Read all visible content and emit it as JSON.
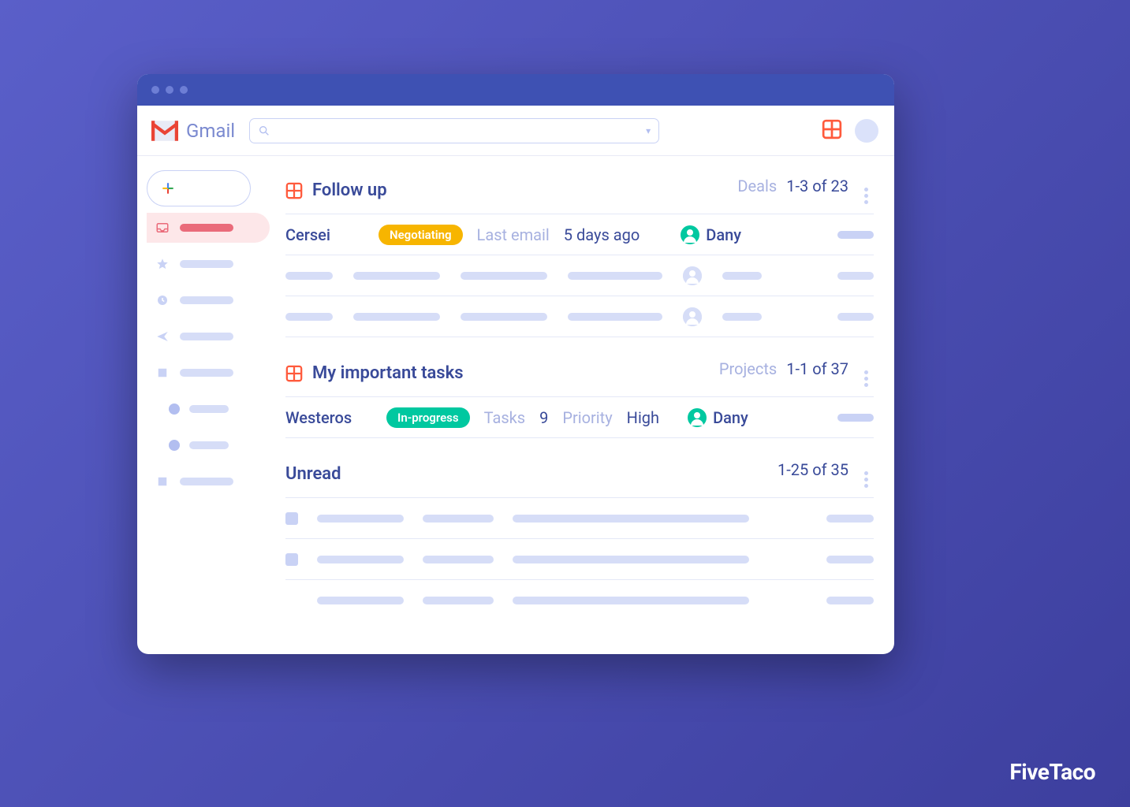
{
  "watermark": "FiveTaco",
  "app": {
    "name": "Gmail"
  },
  "search": {
    "placeholder": ""
  },
  "sections": [
    {
      "title": "Follow up",
      "type_label": "Deals",
      "range_label": "1-3 of 23",
      "rows": [
        {
          "name": "Cersei",
          "status": "Negotiating",
          "status_color": "orange",
          "meta_label": "Last email",
          "meta_value": "5 days ago",
          "assignee": "Dany",
          "assignee_color": "#00c8a0"
        }
      ]
    },
    {
      "title": "My important tasks",
      "type_label": "Projects",
      "range_label": "1-1 of 37",
      "rows": [
        {
          "name": "Westeros",
          "status": "In-progress",
          "status_color": "teal",
          "meta1_label": "Tasks",
          "meta1_value": "9",
          "meta2_label": "Priority",
          "meta2_value": "High",
          "assignee": "Dany",
          "assignee_color": "#00c8a0"
        }
      ]
    },
    {
      "title": "Unread",
      "range_label": "1-25 of 35"
    }
  ]
}
